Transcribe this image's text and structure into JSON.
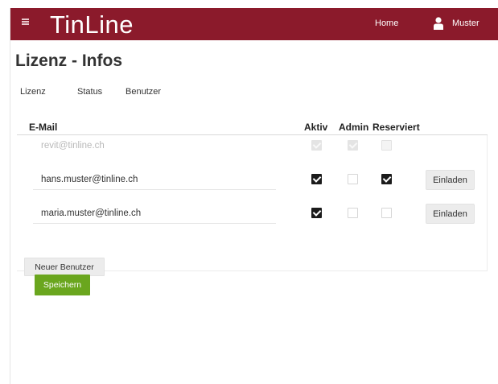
{
  "header": {
    "brand": "TinLine",
    "nav_home": "Home",
    "user_name": "Muster"
  },
  "page": {
    "title": "Lizenz - Infos"
  },
  "tabs": [
    {
      "label": "Lizenz"
    },
    {
      "label": "Status"
    },
    {
      "label": "Benutzer"
    }
  ],
  "table": {
    "columns": {
      "email": "E-Mail",
      "aktiv": "Aktiv",
      "admin": "Admin",
      "reserviert": "Reserviert"
    },
    "rows": [
      {
        "email": "revit@tinline.ch",
        "disabled": true,
        "aktiv": true,
        "admin": true,
        "reserviert": false,
        "invite_label": ""
      },
      {
        "email": "hans.muster@tinline.ch",
        "disabled": false,
        "aktiv": true,
        "admin": false,
        "reserviert": true,
        "invite_label": "Einladen"
      },
      {
        "email": "maria.muster@tinline.ch",
        "disabled": false,
        "aktiv": true,
        "admin": false,
        "reserviert": false,
        "invite_label": "Einladen"
      }
    ]
  },
  "actions": {
    "new_user_label": "Neuer Benutzer",
    "save_label": "Speichern"
  },
  "colors": {
    "header_bg": "#8b1a2b",
    "save_bg": "#6aa61e"
  },
  "icons": {
    "menu": "hamburger-menu-icon",
    "user": "user-icon"
  }
}
